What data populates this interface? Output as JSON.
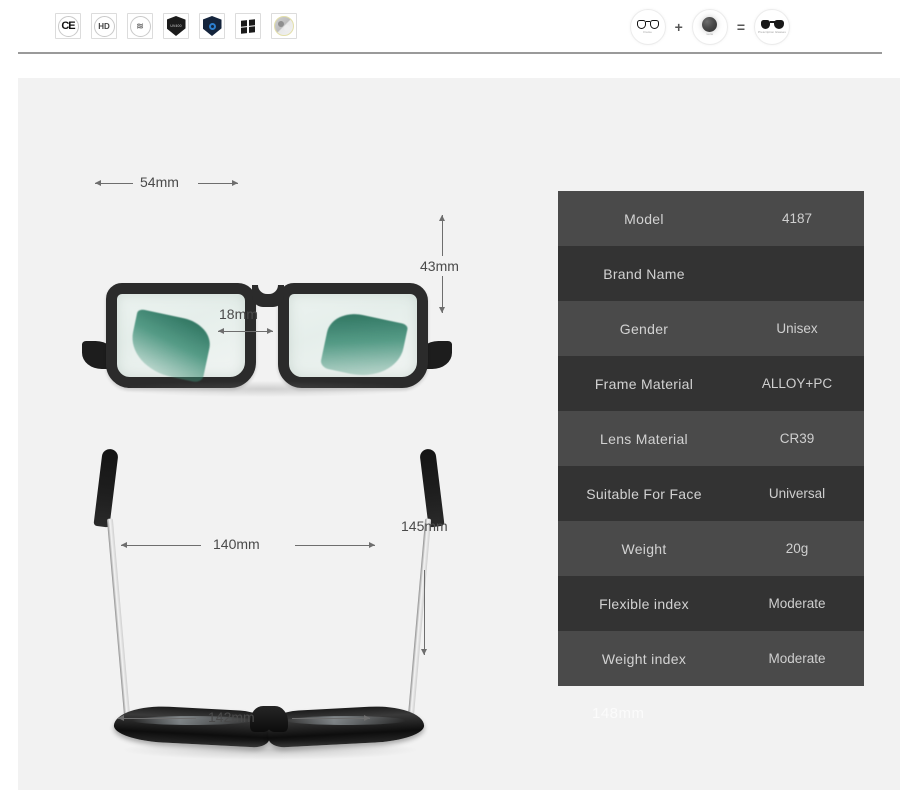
{
  "topbar": {
    "certifications": [
      {
        "name": "ce-certification-icon",
        "label": "CE"
      },
      {
        "name": "hd-icon",
        "label": "HD"
      },
      {
        "name": "anti-radiation-wave-icon",
        "label": "≈"
      },
      {
        "name": "uv-shield-icon",
        "label": "UV400"
      },
      {
        "name": "blue-light-shield-icon",
        "label": "ANTI BLUE"
      },
      {
        "name": "windows-logo-icon",
        "label": ""
      },
      {
        "name": "polarized-circle-icon",
        "label": ""
      }
    ],
    "formula": {
      "frame_caption": "Frame",
      "lens_caption": "Lens",
      "result_caption": "Prescription Glasses",
      "plus": "+",
      "equals": "="
    }
  },
  "dimensions": {
    "lens_width": "54mm",
    "bridge_width": "18mm",
    "lens_height": "43mm",
    "frame_front_width": "140mm",
    "frame_total_width": "142mm",
    "temple_length": "145mm",
    "watermark": "148mm"
  },
  "spec_table": {
    "rows": [
      {
        "key": "Model",
        "value": "4187"
      },
      {
        "key": "Brand Name",
        "value": ""
      },
      {
        "key": "Gender",
        "value": "Unisex"
      },
      {
        "key": "Frame Material",
        "value": "ALLOY+PC"
      },
      {
        "key": "Lens Material",
        "value": "CR39"
      },
      {
        "key": "Suitable For Face",
        "value": "Universal"
      },
      {
        "key": "Weight",
        "value": "20g"
      },
      {
        "key": "Flexible index",
        "value": "Moderate"
      },
      {
        "key": "Weight index",
        "value": "Moderate"
      }
    ]
  },
  "colors": {
    "panel_background": "#f2f2f2",
    "table_row_light": "#4a4a4a",
    "table_row_dark": "#333333",
    "annotation": "#6e6e6e",
    "frame_black": "#2b2b2b",
    "temple_green": "#105e48"
  }
}
